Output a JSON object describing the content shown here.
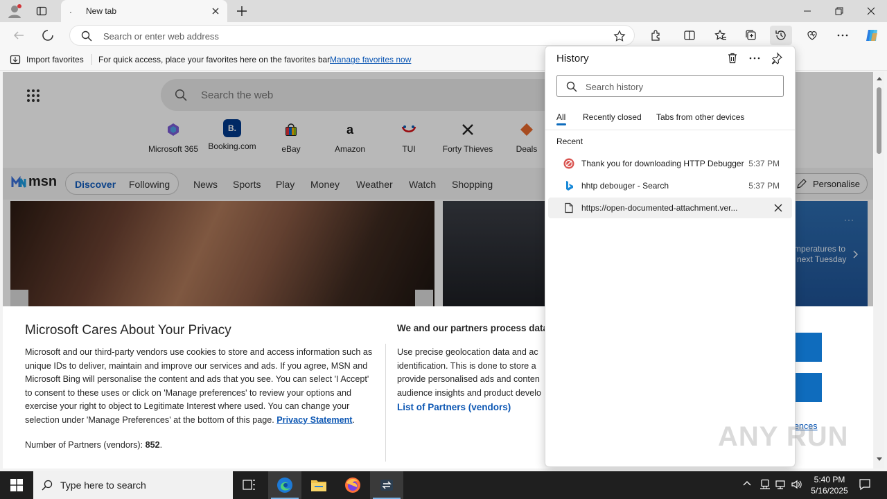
{
  "window": {
    "tab_title": "New tab",
    "tab_favicon": "."
  },
  "toolbar": {
    "address_placeholder": "Search or enter web address"
  },
  "favorites_bar": {
    "import_label": "Import favorites",
    "message": "For quick access, place your favorites here on the favorites bar.",
    "manage_link": "Manage favorites now"
  },
  "newtab": {
    "search_placeholder": "Search the web",
    "quick_links": [
      {
        "label": "Microsoft 365",
        "icon": "microsoft-365-icon"
      },
      {
        "label": "Booking.com",
        "icon": "booking-icon",
        "glyph": "B."
      },
      {
        "label": "eBay",
        "icon": "ebay-bag-icon"
      },
      {
        "label": "Amazon",
        "icon": "amazon-icon",
        "glyph": "a"
      },
      {
        "label": "TUI",
        "icon": "tui-icon"
      },
      {
        "label": "Forty Thieves",
        "icon": "crossed-swords-icon"
      },
      {
        "label": "Deals",
        "icon": "deals-tag-icon"
      }
    ],
    "msn": {
      "logo": "msn",
      "nav": [
        "Discover",
        "Following",
        "News",
        "Sports",
        "Play",
        "Money",
        "Weather",
        "Watch",
        "Shopping"
      ],
      "personalise": "Personalise"
    },
    "weather_card": {
      "line1": "mperatures to",
      "line2": "next Tuesday"
    }
  },
  "consent": {
    "title": "Microsoft Cares About Your Privacy",
    "body": "Microsoft and our third-party vendors use cookies to store and access information such as unique IDs to deliver, maintain and improve our services and ads. If you agree, MSN and Microsoft Bing will personalise the content and ads that you see. You can select 'I Accept' to consent to these uses or click on 'Manage preferences' to review your options and exercise your right to object to Legitimate Interest where used.  You can change your selection under 'Manage Preferences' at the bottom of this page. ",
    "privacy_link": "Privacy Statement",
    "partners_prefix": "Number of Partners (vendors): ",
    "partners_count": "852",
    "partners_suffix": ".",
    "right_title": "We and our partners process data",
    "right_body": "Use precise geolocation data and ac identification. This is done to store a provide personalised ads and conten audience insights and product develo",
    "partners_link": "List of Partners (vendors)",
    "manage_preferences_fragment": "ences"
  },
  "history": {
    "title": "History",
    "search_placeholder": "Search history",
    "tabs": [
      "All",
      "Recently closed",
      "Tabs from other devices"
    ],
    "active_tab": "All",
    "section": "Recent",
    "items": [
      {
        "title": "Thank you for downloading HTTP Debugger",
        "time": "5:37 PM",
        "icon": "http-debugger-favicon"
      },
      {
        "title": "hhtp debouger - Search",
        "time": "5:37 PM",
        "icon": "bing-icon"
      },
      {
        "title": "https://open-documented-attachment.ver...",
        "time": "",
        "icon": "page-icon"
      }
    ]
  },
  "taskbar": {
    "search_placeholder": "Type here to search",
    "time": "5:40 PM",
    "date": "5/16/2025"
  },
  "watermark": "ANY RUN",
  "colors": {
    "accent": "#0f6cbd",
    "link": "#0b56b3",
    "taskbar": "#1f1f1f"
  }
}
